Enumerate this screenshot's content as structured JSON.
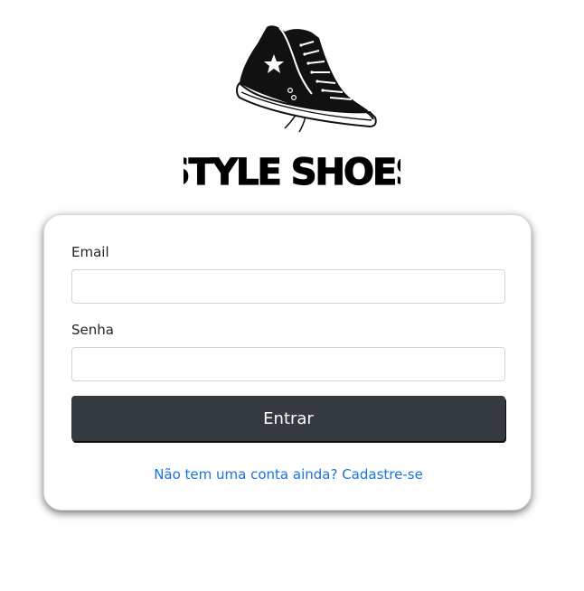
{
  "brand": {
    "logo_icon": "high-top-sneaker-icon",
    "name": "STYLE SHOES"
  },
  "login_form": {
    "email_label": "Email",
    "email_value": "",
    "password_label": "Senha",
    "password_value": "",
    "submit_label": "Entrar",
    "signup_link": "Não tem uma conta ainda? Cadastre-se"
  },
  "colors": {
    "button_bg": "#343a40",
    "link": "#1a73d9"
  }
}
